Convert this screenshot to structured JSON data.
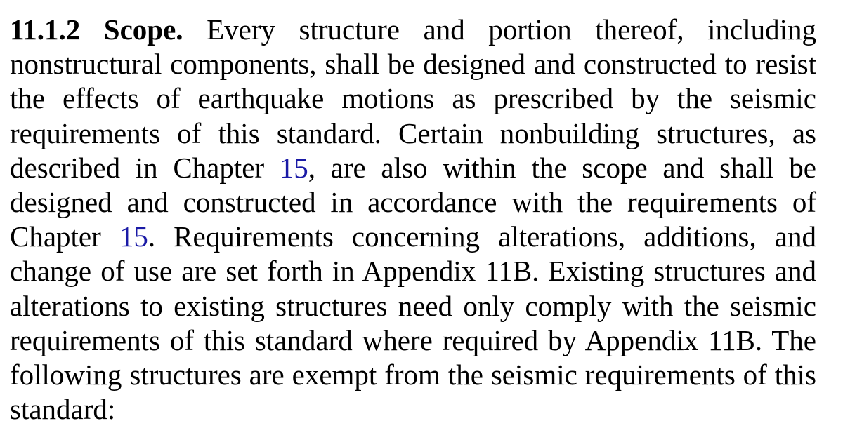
{
  "section": {
    "heading": "11.1.2 Scope.",
    "text_1": " Every structure and portion thereof, including nonstructural components, shall be designed and constructed to resist the effects of earthquake motions as prescribed by the seismic requirements of this standard. Certain nonbuilding structures, as described in Chapter ",
    "link_1": "15",
    "text_2": ", are also within the scope and shall be designed and constructed in accordance with the requirements of Chapter ",
    "link_2": "15",
    "text_3": ". Requirements concerning alterations, additions, and change of use are set forth in Appendix 11B. Existing structures and alterations to existing structures need only comply with the seismic requirements of this standard where required by Appendix 11B. The following structures are exempt from the seismic requirements of this standard:"
  },
  "colors": {
    "text": "#000000",
    "link": "#1a1aa6",
    "background": "#ffffff"
  }
}
